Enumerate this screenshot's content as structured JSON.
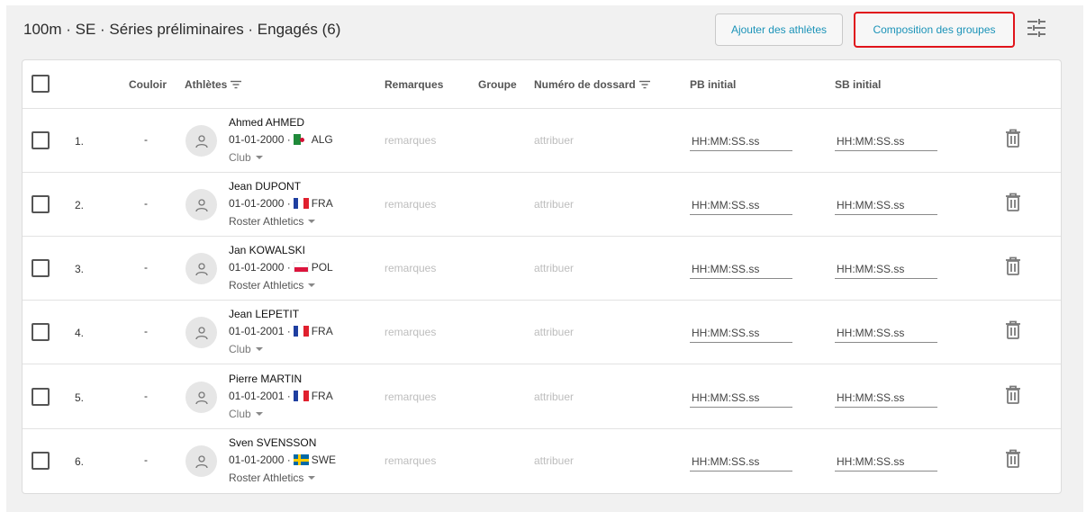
{
  "header": {
    "title": "100m · SE · Séries préliminaires · Engagés (6)",
    "add_athletes_label": "Ajouter des athlètes",
    "group_composition_label": "Composition des groupes"
  },
  "table": {
    "columns": {
      "lane": "Couloir",
      "athletes": "Athlètes",
      "remarks": "Remarques",
      "group": "Groupe",
      "bib": "Numéro de dossard",
      "pb": "PB initial",
      "sb": "SB initial"
    },
    "remarks_placeholder": "remarques",
    "bib_placeholder": "attribuer",
    "time_placeholder": "HH:MM:SS.ss",
    "rows": [
      {
        "index": "1.",
        "lane": "-",
        "name": "Ahmed AHMED",
        "dob": "01-01-2000 ·",
        "country": "ALG",
        "club": "Club",
        "club_muted": true
      },
      {
        "index": "2.",
        "lane": "-",
        "name": "Jean DUPONT",
        "dob": "01-01-2000 ·",
        "country": "FRA",
        "club": "Roster Athletics",
        "club_muted": false
      },
      {
        "index": "3.",
        "lane": "-",
        "name": "Jan KOWALSKI",
        "dob": "01-01-2000 ·",
        "country": "POL",
        "club": "Roster Athletics",
        "club_muted": false
      },
      {
        "index": "4.",
        "lane": "-",
        "name": "Jean LEPETIT",
        "dob": "01-01-2001 ·",
        "country": "FRA",
        "club": "Club",
        "club_muted": true
      },
      {
        "index": "5.",
        "lane": "-",
        "name": "Pierre MARTIN",
        "dob": "01-01-2001 ·",
        "country": "FRA",
        "club": "Club",
        "club_muted": true
      },
      {
        "index": "6.",
        "lane": "-",
        "name": "Sven SVENSSON",
        "dob": "01-01-2000 ·",
        "country": "SWE",
        "club": "Roster Athletics",
        "club_muted": false
      }
    ]
  },
  "colors": {
    "accent": "#1b93b8",
    "highlight_border": "#e0141b"
  },
  "icons": {
    "header": "sliders-settings-icon",
    "filter": "filter-lines-icon",
    "avatar": "person-icon",
    "delete": "trash-icon"
  }
}
